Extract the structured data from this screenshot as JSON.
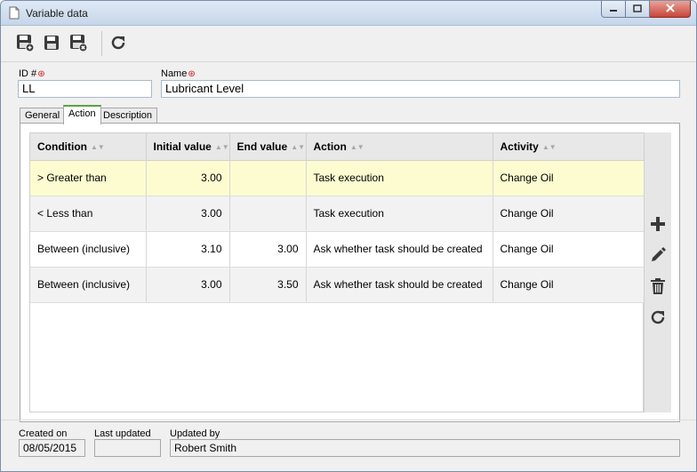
{
  "window": {
    "title": "Variable data",
    "min_icon": "minimize-icon",
    "max_icon": "maximize-icon",
    "close_icon": "close-icon"
  },
  "toolbar": {
    "buttons": [
      {
        "icon": "save-new-icon",
        "tooltip": "Save and new"
      },
      {
        "icon": "save-icon",
        "tooltip": "Save"
      },
      {
        "icon": "save-close-icon",
        "tooltip": "Save and exit"
      },
      {
        "icon": "refresh-icon",
        "tooltip": "Refresh"
      }
    ]
  },
  "form": {
    "id_label": "ID #",
    "id_value": "LL",
    "name_label": "Name",
    "name_value": "Lubricant Level",
    "required_mark": "⊛"
  },
  "tabs": [
    "General",
    "Action",
    "Description"
  ],
  "active_tab": "Action",
  "grid": {
    "columns": [
      "Condition",
      "Initial value",
      "End value",
      "Action",
      "Activity"
    ],
    "rows": [
      {
        "condition": "> Greater than",
        "initial": "3.00",
        "end": "",
        "action": "Task execution",
        "activity": "Change Oil"
      },
      {
        "condition": "< Less than",
        "initial": "3.00",
        "end": "",
        "action": "Task execution",
        "activity": "Change Oil"
      },
      {
        "condition": "Between (inclusive)",
        "initial": "3.10",
        "end": "3.00",
        "action": "Ask whether task should be created",
        "activity": "Change Oil"
      },
      {
        "condition": "Between (inclusive)",
        "initial": "3.00",
        "end": "3.50",
        "action": "Ask whether task should be created",
        "activity": "Change Oil"
      }
    ],
    "side_buttons": [
      "add-icon",
      "edit-icon",
      "delete-icon",
      "refresh-icon"
    ]
  },
  "footer": {
    "created_on_label": "Created on",
    "created_on_value": "08/05/2015",
    "last_updated_label": "Last updated",
    "last_updated_value": "",
    "updated_by_label": "Updated by",
    "updated_by_value": "Robert Smith"
  },
  "colors": {
    "selected_row": "#fcfcd0",
    "alt_row": "#f2f2f2",
    "active_tab_accent": "#5ba240",
    "required": "#d01010"
  }
}
